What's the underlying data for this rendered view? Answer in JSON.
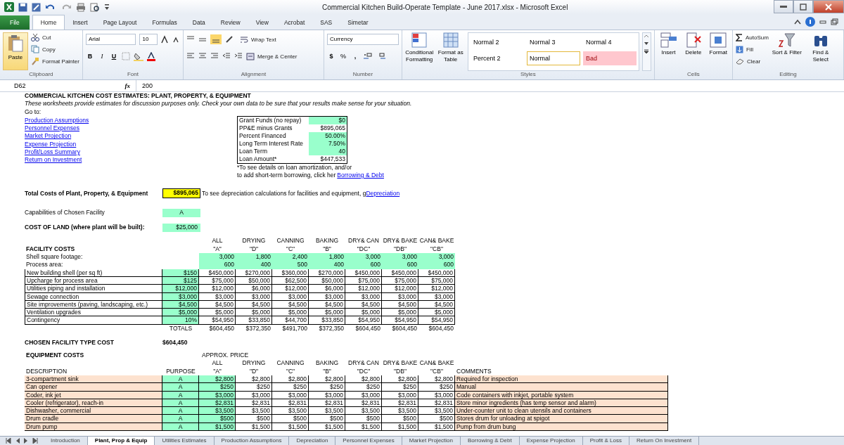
{
  "window": {
    "title": "Commercial Kitchen Build-Operate Template - June 2017.xlsx  -  Microsoft Excel"
  },
  "ribbon_tabs": [
    {
      "label": "File",
      "kind": "file",
      "selected": false
    },
    {
      "label": "Home",
      "kind": "tab",
      "selected": true
    },
    {
      "label": "Insert",
      "kind": "tab",
      "selected": false
    },
    {
      "label": "Page Layout",
      "kind": "tab",
      "selected": false
    },
    {
      "label": "Formulas",
      "kind": "tab",
      "selected": false
    },
    {
      "label": "Data",
      "kind": "tab",
      "selected": false
    },
    {
      "label": "Review",
      "kind": "tab",
      "selected": false
    },
    {
      "label": "View",
      "kind": "tab",
      "selected": false
    },
    {
      "label": "Acrobat",
      "kind": "tab",
      "selected": false
    },
    {
      "label": "SAS",
      "kind": "tab",
      "selected": false
    },
    {
      "label": "Simetar",
      "kind": "tab",
      "selected": false
    }
  ],
  "clipboard": {
    "label": "Clipboard",
    "paste": "Paste",
    "cut": "Cut",
    "copy": "Copy",
    "format_painter": "Format Painter"
  },
  "font": {
    "label": "Font",
    "family": "Arial",
    "size": "10",
    "bold": "B",
    "italic": "I",
    "underline": "U"
  },
  "alignment": {
    "label": "Alignment",
    "wrap_text": "Wrap Text",
    "merge_center": "Merge & Center"
  },
  "number": {
    "label": "Number",
    "format": "Currency",
    "currency": "$",
    "percent": "%",
    "comma": ","
  },
  "styles": {
    "label": "Styles",
    "conditional_formatting": "Conditional Formatting",
    "format_as_table": "Format as Table",
    "cell_styles": [
      {
        "label": "Normal 2",
        "kind": "plain",
        "selected": false
      },
      {
        "label": "Normal 3",
        "kind": "plain",
        "selected": false
      },
      {
        "label": "Normal 4",
        "kind": "plain",
        "selected": false
      },
      {
        "label": "Percent 2",
        "kind": "plain",
        "selected": false
      },
      {
        "label": "Normal",
        "kind": "plain",
        "selected": true
      },
      {
        "label": "Bad",
        "kind": "bad",
        "selected": false
      }
    ]
  },
  "cells": {
    "label": "Cells",
    "buttons": [
      "Insert",
      "Delete",
      "Format"
    ]
  },
  "editing": {
    "label": "Editing",
    "autosum": "AutoSum",
    "fill": "Fill",
    "clear": "Clear",
    "sort_filter": "Sort & Filter",
    "find_select": "Find & Select"
  },
  "formula_bar": {
    "name_box": "D62",
    "fx": "fx",
    "value": "200"
  },
  "sheet": {
    "title": "COMMERCIAL KITCHEN COST ESTIMATES: PLANT, PROPERTY, & EQUIPMENT",
    "subtitle": "These worksheets provide estimates for discussion purposes only.  Check your own data to be sure that your results make sense for your situation.",
    "goto_label": "Go to:",
    "links": [
      "Production Assumptions",
      "Personnel Expenses",
      "Market Projection",
      "Expense Projection",
      "Profit/Loss Summary",
      "Return on Investment"
    ],
    "loan_box": [
      {
        "label": "Grant Funds (no repay)",
        "value": "$0",
        "input": true
      },
      {
        "label": "PP&E minus Grants",
        "value": "$895,065",
        "input": false
      },
      {
        "label": "Percent Financed",
        "value": "50.00%",
        "input": true
      },
      {
        "label": "Long Term Interest Rate",
        "value": "7.50%",
        "input": true
      },
      {
        "label": "Loan Term",
        "value": "40",
        "input": true
      },
      {
        "label": "Loan Amount*",
        "value": "$447,533",
        "input": false
      }
    ],
    "loan_note": "*To see details on loan amortization, and/or",
    "loan_note_2": "to add short-term borrowing, click her",
    "loan_link": "Borrowing & Debt",
    "total": {
      "label": "Total Costs of Plant, Property, & Equipment",
      "value": "$895,065",
      "note": "To see depreciation calculations for facilities and equipment, g",
      "link": "Depreciation"
    },
    "capabilities": {
      "label": "Capabilities of Chosen Facility",
      "value": "A"
    },
    "land": {
      "label": "COST OF LAND (where plant will be built):",
      "value": "$25,000"
    },
    "facility": {
      "title": "FACILITY COSTS",
      "types": [
        {
          "name": "ALL",
          "code": "\"A\""
        },
        {
          "name": "DRYING",
          "code": "\"D\""
        },
        {
          "name": "CANNING",
          "code": "\"C\""
        },
        {
          "name": "BAKING",
          "code": "\"B\""
        },
        {
          "name": "DRY& CAN",
          "code": "\"DC\""
        },
        {
          "name": "DRY& BAKE",
          "code": "\"DB\""
        },
        {
          "name": "CAN& BAKE",
          "code": "\"CB\""
        }
      ],
      "shell_label": "Shell square footage:",
      "shell": [
        "3,000",
        "1,800",
        "2,400",
        "1,800",
        "3,000",
        "3,000",
        "3,000"
      ],
      "process_label": "Process area:",
      "process": [
        "600",
        "400",
        "500",
        "400",
        "600",
        "600",
        "600"
      ],
      "rows": [
        {
          "label": "New building shell (per sq ft)",
          "input": "$150",
          "values": [
            "$450,000",
            "$270,000",
            "$360,000",
            "$270,000",
            "$450,000",
            "$450,000",
            "$450,000"
          ]
        },
        {
          "label": "Upcharge for process area",
          "input": "$125",
          "values": [
            "$75,000",
            "$50,000",
            "$62,500",
            "$50,000",
            "$75,000",
            "$75,000",
            "$75,000"
          ]
        },
        {
          "label": "Utilities piping and installation",
          "input": "$12,000",
          "values": [
            "$12,000",
            "$6,000",
            "$12,000",
            "$6,000",
            "$12,000",
            "$12,000",
            "$12,000"
          ]
        },
        {
          "label": "Sewage connection",
          "input": "$3,000",
          "values": [
            "$3,000",
            "$3,000",
            "$3,000",
            "$3,000",
            "$3,000",
            "$3,000",
            "$3,000"
          ]
        },
        {
          "label": "Site improvements (paving, landscaping, etc.)",
          "input": "$4,500",
          "values": [
            "$4,500",
            "$4,500",
            "$4,500",
            "$4,500",
            "$4,500",
            "$4,500",
            "$4,500"
          ]
        },
        {
          "label": "Ventilation upgrades",
          "input": "$5,000",
          "values": [
            "$5,000",
            "$5,000",
            "$5,000",
            "$5,000",
            "$5,000",
            "$5,000",
            "$5,000"
          ]
        },
        {
          "label": "Contingency",
          "input": "10%",
          "values": [
            "$54,950",
            "$33,850",
            "$44,700",
            "$33,850",
            "$54,950",
            "$54,950",
            "$54,950"
          ]
        }
      ],
      "totals_label": "TOTALS",
      "totals": [
        "$604,450",
        "$372,350",
        "$491,700",
        "$372,350",
        "$604,450",
        "$604,450",
        "$604,450"
      ]
    },
    "chosen": {
      "label": "CHOSEN FACILITY TYPE COST",
      "value": "$604,450"
    },
    "equipment": {
      "title": "EQUIPMENT COSTS",
      "types": [
        {
          "name": "ALL",
          "code": "\"A\""
        },
        {
          "name": "DRYING",
          "code": "\"D\""
        },
        {
          "name": "CANNING",
          "code": "\"C\""
        },
        {
          "name": "BAKING",
          "code": "\"B\""
        },
        {
          "name": "DRY& CAN",
          "code": "\"DC\""
        },
        {
          "name": "DRY& BAKE",
          "code": "\"DB\""
        },
        {
          "name": "CAN& BAKE",
          "code": "\"CB\""
        }
      ],
      "price_label": "APPROX. PRICE",
      "description_label": "DESCRIPTION",
      "purpose_label": "PURPOSE",
      "comments_label": "COMMENTS",
      "rows": [
        {
          "description": "3-compartment sink",
          "purpose": "A",
          "values": [
            "$2,800",
            "$2,800",
            "$2,800",
            "$2,800",
            "$2,800",
            "$2,800",
            "$2,800"
          ],
          "comment": "Required for inspection"
        },
        {
          "description": "Can opener",
          "purpose": "A",
          "values": [
            "$250",
            "$250",
            "$250",
            "$250",
            "$250",
            "$250",
            "$250"
          ],
          "comment": "Manual"
        },
        {
          "description": "Coder, ink jet",
          "purpose": "A",
          "values": [
            "$3,000",
            "$3,000",
            "$3,000",
            "$3,000",
            "$3,000",
            "$3,000",
            "$3,000"
          ],
          "comment": "Code containers with inkjet, portable system"
        },
        {
          "description": "Cooler (refrigerator), reach-in",
          "purpose": "A",
          "values": [
            "$2,831",
            "$2,831",
            "$2,831",
            "$2,831",
            "$2,831",
            "$2,831",
            "$2,831"
          ],
          "comment": "Store minor ingredients (has temp sensor and alarm)"
        },
        {
          "description": "Dishwasher, commercial",
          "purpose": "A",
          "values": [
            "$3,500",
            "$3,500",
            "$3,500",
            "$3,500",
            "$3,500",
            "$3,500",
            "$3,500"
          ],
          "comment": "Under-counter unit to clean utensils and containers"
        },
        {
          "description": "Drum cradle",
          "purpose": "A",
          "values": [
            "$500",
            "$500",
            "$500",
            "$500",
            "$500",
            "$500",
            "$500"
          ],
          "comment": "Stores drum for unloading at spigot"
        },
        {
          "description": "Drum pump",
          "purpose": "A",
          "values": [
            "$1,500",
            "$1,500",
            "$1,500",
            "$1,500",
            "$1,500",
            "$1,500",
            "$1,500"
          ],
          "comment": "Pump from drum bung"
        }
      ]
    }
  },
  "sheet_tabs": [
    {
      "label": "Introduction",
      "selected": false
    },
    {
      "label": "Plant, Prop & Equip",
      "selected": true
    },
    {
      "label": "Utilities Estimates",
      "selected": false
    },
    {
      "label": "Production Assumptions",
      "selected": false
    },
    {
      "label": "Depreciation",
      "selected": false
    },
    {
      "label": "Personnel Expenses",
      "selected": false
    },
    {
      "label": "Market Projection",
      "selected": false
    },
    {
      "label": "Borrowing & Debt",
      "selected": false
    },
    {
      "label": "Expense Projection",
      "selected": false
    },
    {
      "label": "Profit & Loss",
      "selected": false
    },
    {
      "label": "Return On Investment",
      "selected": false
    }
  ]
}
